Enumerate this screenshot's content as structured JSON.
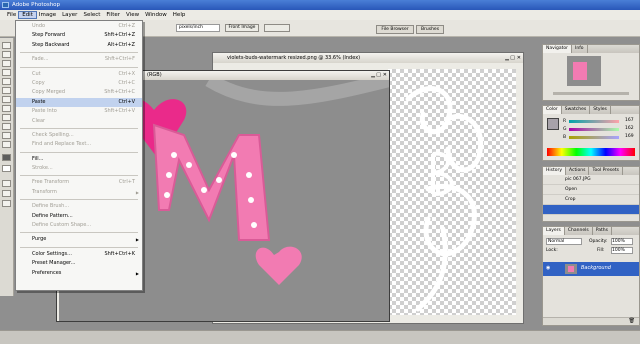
{
  "app": {
    "title": "Adobe Photoshop"
  },
  "menubar": {
    "items": [
      "File",
      "Edit",
      "Image",
      "Layer",
      "Select",
      "Filter",
      "View",
      "Window",
      "Help"
    ],
    "active_index": 1
  },
  "options": {
    "field1": "pixels/inch",
    "button1": "Front Image",
    "tab1": "File Browser",
    "tab2": "Brushes"
  },
  "edit_menu": {
    "items": [
      {
        "label": "Undo",
        "shortcut": "Ctrl+Z",
        "disabled": true
      },
      {
        "label": "Step Forward",
        "shortcut": "Shft+Ctrl+Z",
        "disabled": false
      },
      {
        "label": "Step Backward",
        "shortcut": "Alt+Ctrl+Z",
        "disabled": false
      },
      {
        "sep": true
      },
      {
        "label": "Fade...",
        "shortcut": "Shft+Ctrl+F",
        "disabled": true
      },
      {
        "sep": true
      },
      {
        "label": "Cut",
        "shortcut": "Ctrl+X",
        "disabled": true
      },
      {
        "label": "Copy",
        "shortcut": "Ctrl+C",
        "disabled": true
      },
      {
        "label": "Copy Merged",
        "shortcut": "Shft+Ctrl+C",
        "disabled": true
      },
      {
        "label": "Paste",
        "shortcut": "Ctrl+V",
        "disabled": false,
        "highlight": true
      },
      {
        "label": "Paste Into",
        "shortcut": "Shft+Ctrl+V",
        "disabled": true
      },
      {
        "label": "Clear",
        "shortcut": "",
        "disabled": true
      },
      {
        "sep": true
      },
      {
        "label": "Check Spelling...",
        "shortcut": "",
        "disabled": true
      },
      {
        "label": "Find and Replace Text...",
        "shortcut": "",
        "disabled": true
      },
      {
        "sep": true
      },
      {
        "label": "Fill...",
        "shortcut": "",
        "disabled": false
      },
      {
        "label": "Stroke...",
        "shortcut": "",
        "disabled": true
      },
      {
        "sep": true
      },
      {
        "label": "Free Transform",
        "shortcut": "Ctrl+T",
        "disabled": true
      },
      {
        "label": "Transform",
        "shortcut": "",
        "disabled": true,
        "submenu": true
      },
      {
        "sep": true
      },
      {
        "label": "Define Brush...",
        "shortcut": "",
        "disabled": true
      },
      {
        "label": "Define Pattern...",
        "shortcut": "",
        "disabled": false
      },
      {
        "label": "Define Custom Shape...",
        "shortcut": "",
        "disabled": true
      },
      {
        "sep": true
      },
      {
        "label": "Purge",
        "shortcut": "",
        "disabled": false,
        "submenu": true
      },
      {
        "sep": true
      },
      {
        "label": "Color Settings...",
        "shortcut": "Shft+Ctrl+K",
        "disabled": false
      },
      {
        "label": "Preset Manager...",
        "shortcut": "",
        "disabled": false
      },
      {
        "label": "Preferences",
        "shortcut": "",
        "disabled": false,
        "submenu": true
      }
    ]
  },
  "doc1": {
    "title": "(RGB)"
  },
  "doc2": {
    "title": "violets-buds-watermark resized.png @ 33.6% (Index)"
  },
  "navigator": {
    "tabs": [
      "Navigator",
      "Info"
    ]
  },
  "color": {
    "tabs": [
      "Color",
      "Swatches",
      "Styles"
    ],
    "channels": [
      {
        "label": "R",
        "value": "167"
      },
      {
        "label": "G",
        "value": "162"
      },
      {
        "label": "B",
        "value": "169"
      }
    ]
  },
  "history": {
    "tabs": [
      "History",
      "Actions",
      "Tool Presets"
    ],
    "snapshot": "pic 067.JPG",
    "rows": [
      "Open",
      "Crop",
      ""
    ]
  },
  "layers": {
    "tabs": [
      "Layers",
      "Channels",
      "Paths"
    ],
    "blend_mode": "Normal",
    "opacity_label": "Opacity:",
    "opacity": "100%",
    "lock_label": "Lock:",
    "fill_label": "Fill:",
    "fill": "100%",
    "layer_name": "Background"
  },
  "colors": {
    "menu_highlight": "#c1d2ee",
    "pink": "#f27bb2",
    "hot_pink": "#ea2a8a",
    "shirt_gray": "#8c8c8c",
    "panel_select": "#3162c4"
  }
}
